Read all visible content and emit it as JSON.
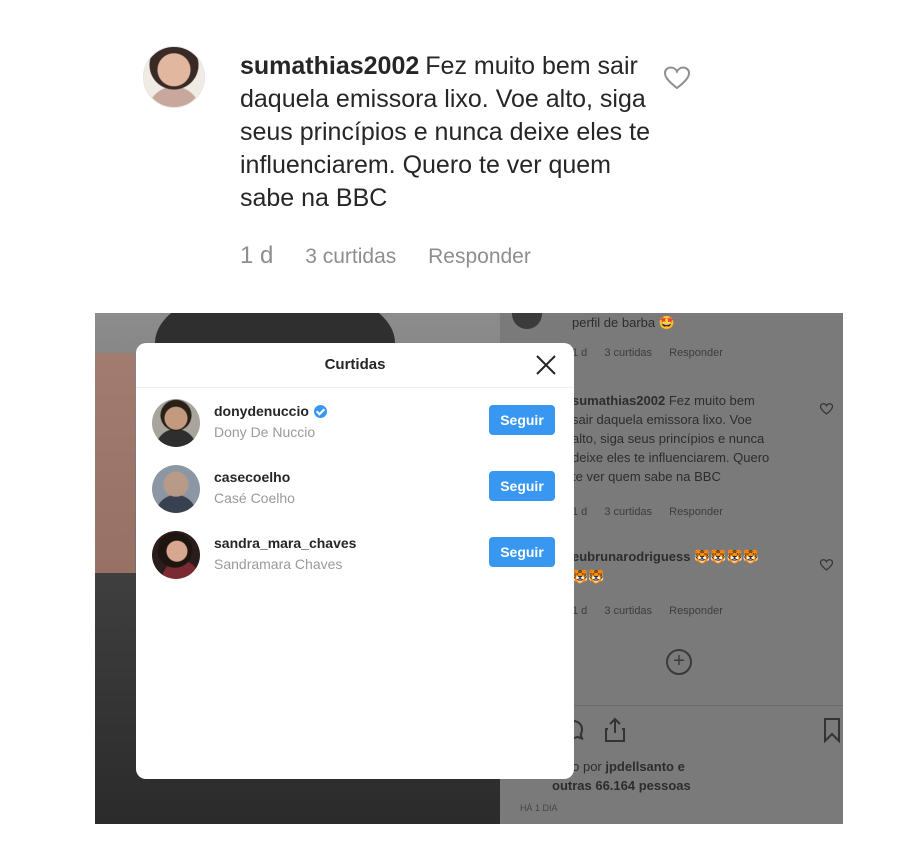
{
  "comment": {
    "username": "sumathias2002",
    "text": "Fez muito bem sair daquela emissora lixo. Voe alto, siga seus princípios e nunca deixe eles te influenciarem. Quero te ver quem sabe na BBC",
    "time": "1 d",
    "likes": "3 curtidas",
    "reply": "Responder"
  },
  "background_post": {
    "comments": [
      {
        "text_lines": [
          "perfil de barba 🤩"
        ],
        "time": "1 d",
        "likes": "3 curtidas",
        "reply": "Responder"
      },
      {
        "username": "sumathias2002",
        "text_lines": [
          " Fez muito bem",
          "sair daquela emissora lixo. Voe",
          "alto, siga seus princípios e nunca",
          "deixe eles te influenciarem. Quero",
          "te ver quem sabe na BBC"
        ],
        "time": "1 d",
        "likes": "3 curtidas",
        "reply": "Responder"
      },
      {
        "username": "eubrunarodriguess",
        "text_lines": [
          " 🐯🐯🐯🐯",
          "🐯🐯"
        ],
        "time": "1 d",
        "likes": "3 curtidas",
        "reply": "Responder"
      }
    ],
    "liked_by_prefix": "ido por ",
    "liked_by_user": "jpdellsanto",
    "liked_by_suffix": " e",
    "others": "outras 66.164 pessoas",
    "post_age": "HÁ 1 DIA"
  },
  "modal": {
    "title": "Curtidas",
    "users": [
      {
        "username": "donydenuccio",
        "name": "Dony De Nuccio",
        "verified": true,
        "button": "Seguir"
      },
      {
        "username": "casecoelho",
        "name": "Casé Coelho",
        "verified": false,
        "button": "Seguir"
      },
      {
        "username": "sandra_mara_chaves",
        "name": "Sandramara Chaves",
        "verified": false,
        "button": "Seguir"
      }
    ]
  },
  "colors": {
    "follow_button": "#3897f0",
    "text": "#262626",
    "muted": "#8e8e8e"
  }
}
